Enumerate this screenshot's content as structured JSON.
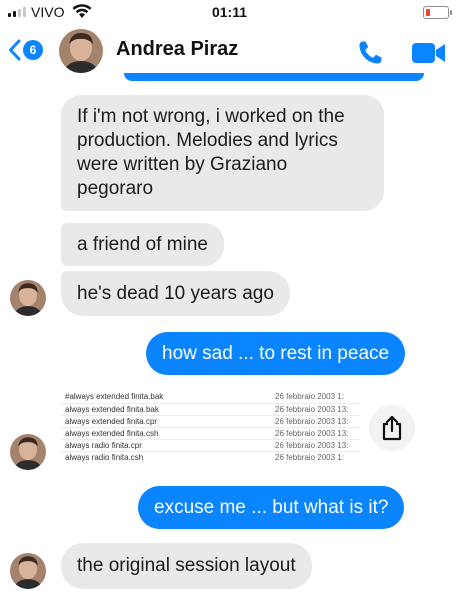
{
  "status_bar": {
    "carrier": "VIVO",
    "time": "01:11",
    "signal_bars": 4,
    "signal_active": 2,
    "battery_level": 0.1,
    "battery_color": "#ff3b30"
  },
  "header": {
    "back_badge": "6",
    "contact_name": "Andrea Piraz",
    "call_icon": "phone-icon",
    "video_icon": "video-camera-icon",
    "accent_color": "#0a84ff"
  },
  "messages": [
    {
      "direction": "received",
      "text": "If i'm not wrong, i worked on the production. Melodies and lyrics were written by Graziano pegoraro"
    },
    {
      "direction": "received",
      "text": "a friend of mine"
    },
    {
      "direction": "received",
      "text": "he's dead 10 years ago"
    },
    {
      "direction": "sent",
      "text": "how sad ... to rest in peace"
    },
    {
      "direction": "received",
      "type": "image-file-list"
    },
    {
      "direction": "sent",
      "text": "excuse me ... but what is it?"
    },
    {
      "direction": "received",
      "text": "the original session layout"
    }
  ],
  "file_list": [
    {
      "name": "#always extended finita.bak",
      "date": "26 febbraio 2003 1:"
    },
    {
      "name": "always extended finita.bak",
      "date": "26 febbraio 2003 13:"
    },
    {
      "name": "always extended finita.cpr",
      "date": "26 febbraio 2003 13:"
    },
    {
      "name": "always extended finita.csh",
      "date": "26 febbraio 2003 13:"
    },
    {
      "name": "always radio finita.cpr",
      "date": "26 febbraio 2003 13:"
    },
    {
      "name": "always radio finita.csh",
      "date": "26 febbraio 2003 1:"
    }
  ],
  "share_icon": "share-icon"
}
